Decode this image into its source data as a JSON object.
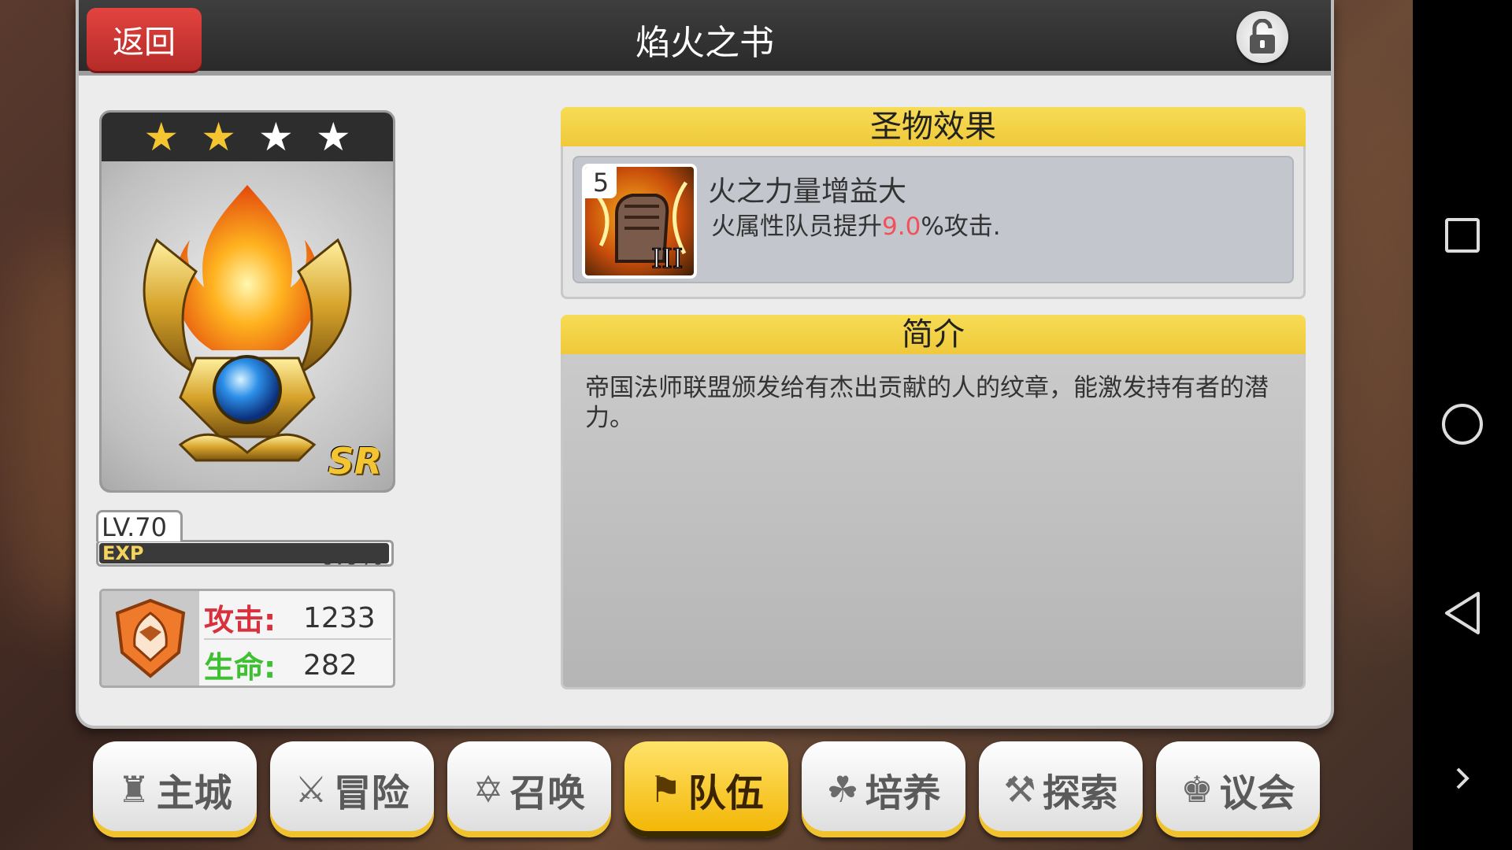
{
  "header": {
    "back_label": "返回",
    "title": "焰火之书"
  },
  "card": {
    "stars": [
      "★",
      "★",
      "★",
      "★"
    ],
    "rarity": "SR",
    "level_label": "LV.70",
    "exp_percent": "0.0%",
    "exp_fill": 0.0,
    "exp_label": "EXP"
  },
  "stats": {
    "attack_label": "攻击:",
    "attack_value": "1233",
    "hp_label": "生命:",
    "hp_value": "282"
  },
  "effect": {
    "section_title": "圣物效果",
    "skill_level": "5",
    "skill_name": "火之力量增益大",
    "desc_prefix": "火属性队员提升",
    "desc_value": "9.0",
    "desc_suffix": "%攻击."
  },
  "intro": {
    "section_title": "简介",
    "text": "帝国法师联盟颁发给有杰出贡献的人的纹章，能激发持有者的潜力。"
  },
  "tabs": [
    {
      "label": "主城",
      "icon": "castle-icon"
    },
    {
      "label": "冒险",
      "icon": "crossed-swords-icon"
    },
    {
      "label": "召唤",
      "icon": "hexagram-icon"
    },
    {
      "label": "队伍",
      "icon": "team-flag-icon"
    },
    {
      "label": "培养",
      "icon": "triple-orb-icon"
    },
    {
      "label": "探索",
      "icon": "explorer-icon"
    },
    {
      "label": "议会",
      "icon": "council-icon"
    }
  ],
  "active_tab": "队伍",
  "colors": {
    "accent_yellow": "#f7dc55",
    "back_red": "#d93a36",
    "highlight_red": "#f2505a",
    "attack_red": "#d8313d",
    "hp_green": "#3fbf33"
  }
}
